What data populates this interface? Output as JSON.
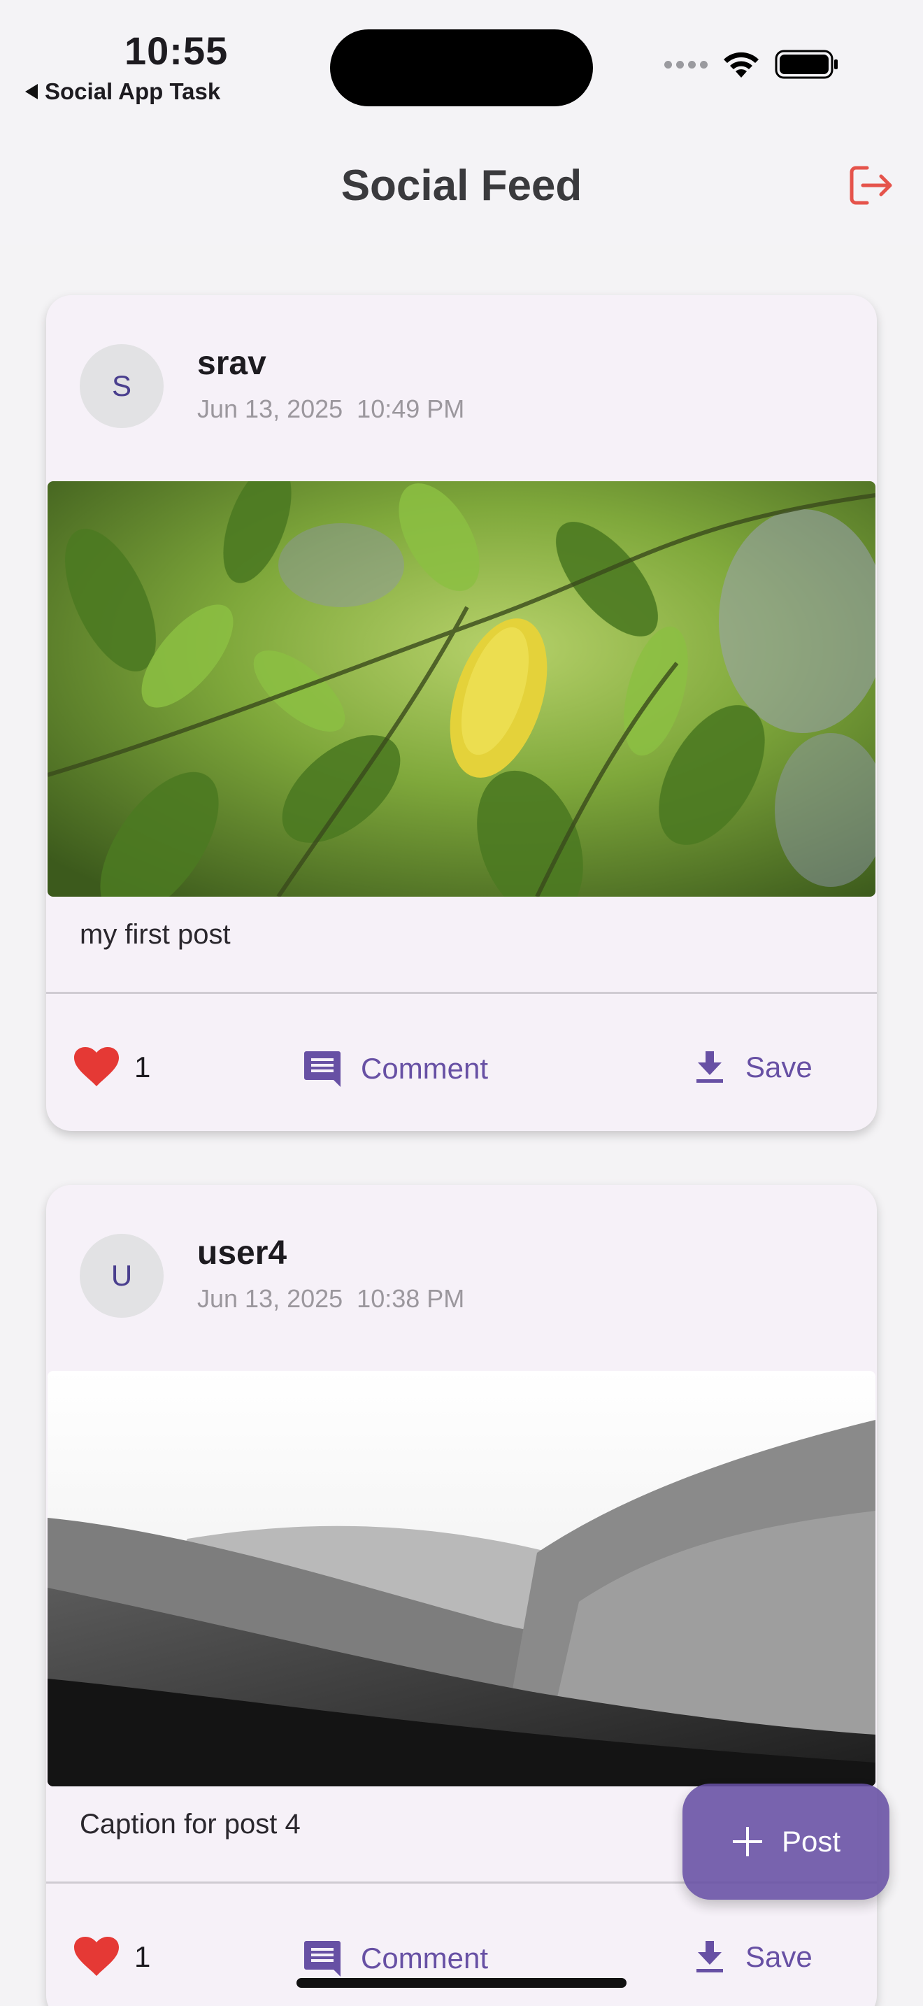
{
  "status_bar": {
    "time": "10:55",
    "back_app": "Social App Task"
  },
  "app_bar": {
    "title": "Social Feed",
    "logout_icon": "logout-icon",
    "logout_color": "#e5534b"
  },
  "posts": [
    {
      "avatar_letter": "S",
      "username": "srav",
      "timestamp": "Jun 13, 2025  10:49 PM",
      "caption": "my first post",
      "likes": "1",
      "comment_label": "Comment",
      "save_label": "Save"
    },
    {
      "avatar_letter": "U",
      "username": "user4",
      "timestamp": "Jun 13, 2025  10:38 PM",
      "caption": "Caption for post 4",
      "likes": "1",
      "comment_label": "Comment",
      "save_label": "Save"
    }
  ],
  "fab": {
    "label": "Post"
  },
  "colors": {
    "accent": "#6750a4",
    "like": "#e53935",
    "card": "#f6f1f8",
    "background": "#f4f3f5"
  }
}
